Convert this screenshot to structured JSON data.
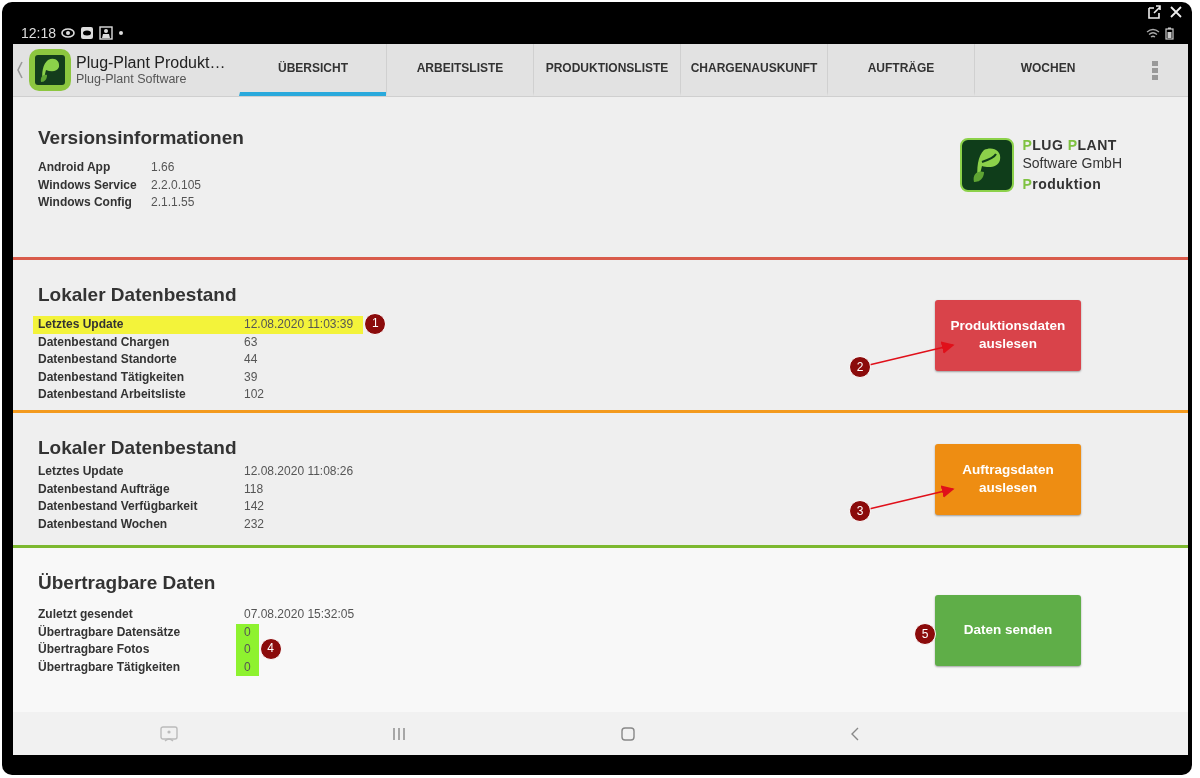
{
  "status_bar": {
    "time": "12:18"
  },
  "app_bar": {
    "title": "Plug-Plant Produkt…",
    "subtitle": "Plug-Plant Software"
  },
  "tabs": [
    {
      "label": "ÜBERSICHT",
      "selected": true
    },
    {
      "label": "ARBEITSLISTE",
      "selected": false
    },
    {
      "label": "PRODUKTIONSLISTE",
      "selected": false
    },
    {
      "label": "CHARGENAUSKUNFT",
      "selected": false
    },
    {
      "label": "AUFTRÄGE",
      "selected": false
    },
    {
      "label": "WOCHEN",
      "selected": false
    }
  ],
  "sections": [
    {
      "kind": "info",
      "title": "Versionsinformationen",
      "rows": [
        {
          "label": "Android App",
          "value": "1.66",
          "highlighted": false,
          "value_highlighted": false
        },
        {
          "label": "Windows Service",
          "value": "2.2.0.105",
          "highlighted": false,
          "value_highlighted": false
        },
        {
          "label": "Windows Config",
          "value": "2.1.1.55",
          "highlighted": false,
          "value_highlighted": false
        }
      ],
      "logo": {
        "lines": [
          [
            {
              "text": "P",
              "accent": true
            },
            {
              "text": "LUG ",
              "accent": false
            },
            {
              "text": "P",
              "accent": true
            },
            {
              "text": "LANT",
              "accent": false
            }
          ],
          [
            {
              "text": "Software GmbH",
              "accent": false
            }
          ],
          [
            {
              "text": "P",
              "accent": true
            },
            {
              "text": "roduktion",
              "accent": false
            }
          ]
        ]
      }
    },
    {
      "kind": "data",
      "title": "Lokaler Datenbestand",
      "color": "#d95b4b",
      "rows": [
        {
          "label": "Letztes Update",
          "value": "12.08.2020 11:03:39",
          "highlighted": true,
          "value_highlighted": false,
          "callout": "1"
        },
        {
          "label": "Datenbestand Chargen",
          "value": "63",
          "highlighted": false,
          "value_highlighted": false
        },
        {
          "label": "Datenbestand Standorte",
          "value": "44",
          "highlighted": false,
          "value_highlighted": false
        },
        {
          "label": "Datenbestand Tätigkeiten",
          "value": "39",
          "highlighted": false,
          "value_highlighted": false
        },
        {
          "label": "Datenbestand Arbeitsliste",
          "value": "102",
          "highlighted": false,
          "value_highlighted": false
        }
      ],
      "button": {
        "label": "Produktionsdaten auslesen",
        "color": "#d9434a",
        "callout": "2",
        "arrow": true
      }
    },
    {
      "kind": "data",
      "title": "Lokaler Datenbestand",
      "color": "#f39a1e",
      "rows": [
        {
          "label": "Letztes Update",
          "value": "12.08.2020 11:08:26",
          "highlighted": false,
          "value_highlighted": false
        },
        {
          "label": "Datenbestand Aufträge",
          "value": "118",
          "highlighted": false,
          "value_highlighted": false
        },
        {
          "label": "Datenbestand Verfügbarkeit",
          "value": "142",
          "highlighted": false,
          "value_highlighted": false
        },
        {
          "label": "Datenbestand Wochen",
          "value": "232",
          "highlighted": false,
          "value_highlighted": false
        }
      ],
      "button": {
        "label": "Auftragsdaten auslesen",
        "color": "#ee8d12",
        "callout": "3",
        "arrow": true
      }
    },
    {
      "kind": "data",
      "title": "Übertragbare Daten",
      "color": "#7cb82f",
      "rows": [
        {
          "label": "Zuletzt gesendet",
          "value": "07.08.2020 15:32:05",
          "highlighted": false,
          "value_highlighted": false
        },
        {
          "label": "Übertragbare Datensätze",
          "value": "0",
          "highlighted": false,
          "value_highlighted": true
        },
        {
          "label": "Übertragbare Fotos",
          "value": "0",
          "highlighted": false,
          "value_highlighted": true,
          "callout": "4"
        },
        {
          "label": "Übertragbare Tätigkeiten",
          "value": "0",
          "highlighted": false,
          "value_highlighted": true
        }
      ],
      "button": {
        "label": "Daten senden",
        "color": "#5fae48",
        "callout": "5",
        "arrow": false
      }
    }
  ]
}
